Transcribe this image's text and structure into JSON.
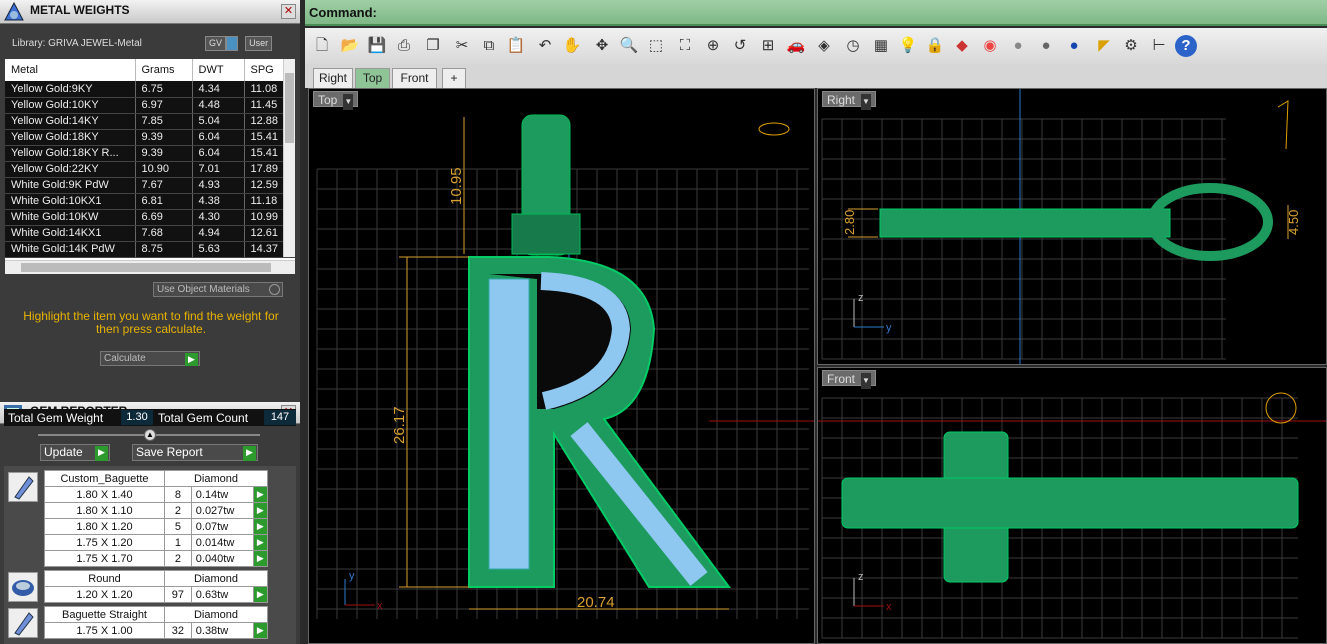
{
  "metal_weights": {
    "title": "METAL WEIGHTS",
    "library_label": "Library: GRIVA JEWEL-Metal",
    "toggle_gv": "GV",
    "toggle_user": "User",
    "columns": [
      "Metal",
      "Grams",
      "DWT",
      "SPG"
    ],
    "rows": [
      [
        "Yellow Gold:9KY",
        "6.75",
        "4.34",
        "11.08"
      ],
      [
        "Yellow Gold:10KY",
        "6.97",
        "4.48",
        "11.45"
      ],
      [
        "Yellow Gold:14KY",
        "7.85",
        "5.04",
        "12.88"
      ],
      [
        "Yellow Gold:18KY",
        "9.39",
        "6.04",
        "15.41"
      ],
      [
        "Yellow Gold:18KY R...",
        "9.39",
        "6.04",
        "15.41"
      ],
      [
        "Yellow Gold:22KY",
        "10.90",
        "7.01",
        "17.89"
      ],
      [
        "White Gold:9K PdW",
        "7.67",
        "4.93",
        "12.59"
      ],
      [
        "White Gold:10KX1",
        "6.81",
        "4.38",
        "11.18"
      ],
      [
        "White Gold:10KW",
        "6.69",
        "4.30",
        "10.99"
      ],
      [
        "White Gold:14KX1",
        "7.68",
        "4.94",
        "12.61"
      ],
      [
        "White Gold:14K PdW",
        "8.75",
        "5.63",
        "14.37"
      ]
    ],
    "use_object_materials": "Use Object Materials",
    "hint": "Highlight the item you want to find the weight for then press calculate.",
    "calculate": "Calculate"
  },
  "gem_reporter": {
    "title": "GEM REPORTER",
    "total_weight_label": "Total Gem Weight",
    "total_weight": "1.30",
    "total_count_label": "Total Gem Count",
    "total_count": "147",
    "update": "Update",
    "save_report": "Save Report",
    "groups": [
      {
        "name": "Custom_Baguette",
        "material": "Diamond",
        "rows": [
          [
            "1.80 X 1.40",
            "8",
            "0.14tw"
          ],
          [
            "1.80 X 1.10",
            "2",
            "0.027tw"
          ],
          [
            "1.80 X 1.20",
            "5",
            "0.07tw"
          ],
          [
            "1.75 X 1.20",
            "1",
            "0.014tw"
          ],
          [
            "1.75 X 1.70",
            "2",
            "0.040tw"
          ]
        ]
      },
      {
        "name": "Round",
        "material": "Diamond",
        "rows": [
          [
            "1.20 X 1.20",
            "97",
            "0.63tw"
          ]
        ]
      },
      {
        "name": "Baguette Straight",
        "material": "Diamond",
        "rows": [
          [
            "1.75 X 1.00",
            "32",
            "0.38tw"
          ]
        ]
      }
    ]
  },
  "command": {
    "label": "Command:"
  },
  "tabs": [
    "Right",
    "Top",
    "Front"
  ],
  "viewports": {
    "top": "Top",
    "right": "Right",
    "front": "Front"
  },
  "dimensions": {
    "top_width": "20.74",
    "top_height": "26.17",
    "top_bail": "10.95",
    "right_thick": "2.80",
    "right_ring": "4.50"
  },
  "axes": {
    "y": "y",
    "x": "x",
    "z": "z"
  },
  "colors": {
    "metal": "#1d9a5e",
    "stone": "#8ec7f0",
    "dim": "#d8a030",
    "cmdbar": "#8fc497"
  }
}
